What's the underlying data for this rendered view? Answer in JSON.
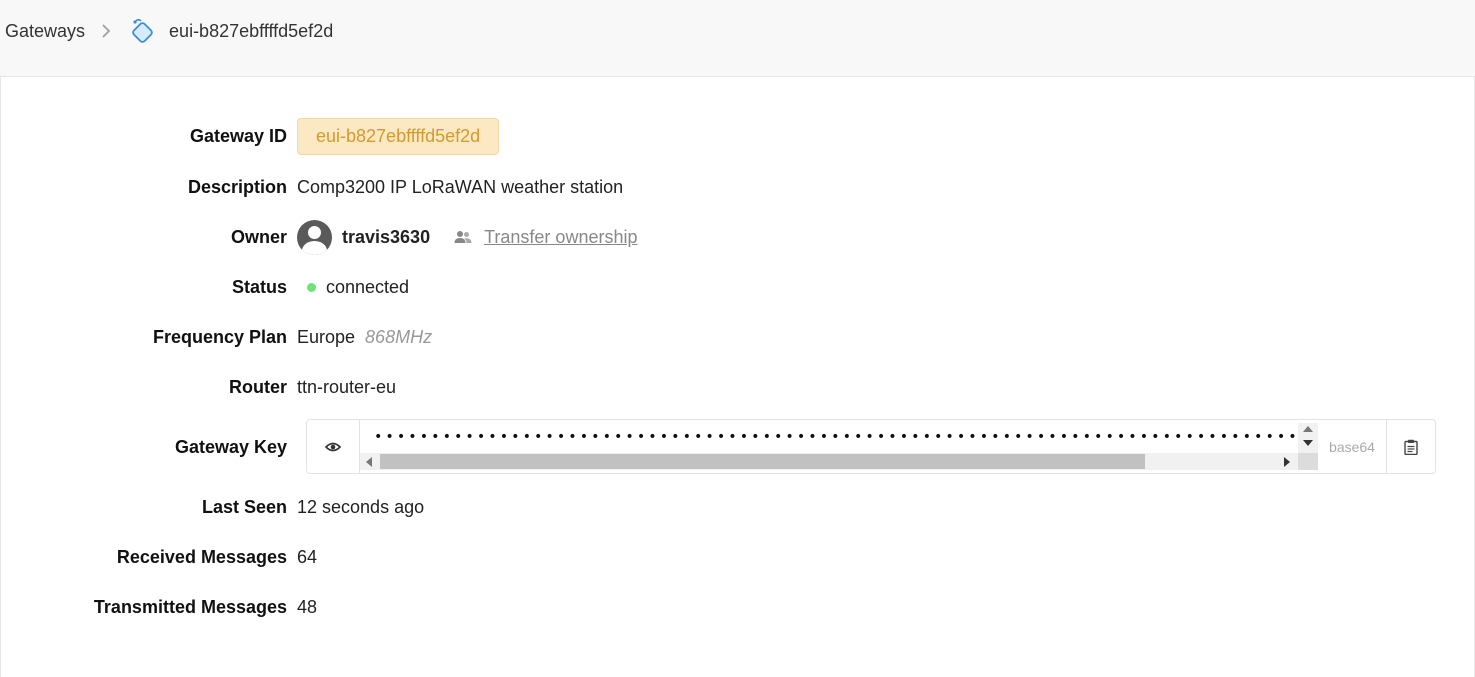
{
  "breadcrumb": {
    "root": "Gateways",
    "current": "eui-b827ebffffd5ef2d"
  },
  "fields": {
    "gateway_id": {
      "label": "Gateway ID",
      "value": "eui-b827ebffffd5ef2d"
    },
    "description": {
      "label": "Description",
      "value": "Comp3200 IP LoRaWAN weather station"
    },
    "owner": {
      "label": "Owner",
      "username": "travis3630",
      "transfer_label": "Transfer ownership"
    },
    "status": {
      "label": "Status",
      "value": "connected",
      "color": "#6ee27a"
    },
    "frequency_plan": {
      "label": "Frequency Plan",
      "region": "Europe",
      "band": "868MHz"
    },
    "router": {
      "label": "Router",
      "value": "ttn-router-eu"
    },
    "gateway_key": {
      "label": "Gateway Key",
      "masked": "••••••••••••••••••••••••••••••••••••••••••••••••••••••••••••••••••••••••••••••••••••••••••••••••••••",
      "encoding": "base64"
    },
    "last_seen": {
      "label": "Last Seen",
      "value": "12 seconds ago"
    },
    "received": {
      "label": "Received Messages",
      "value": "64"
    },
    "transmitted": {
      "label": "Transmitted Messages",
      "value": "48"
    }
  },
  "icons": {
    "breadcrumb_sep": "chevron-right-icon",
    "gateway": "gateway-icon",
    "avatar": "user-avatar-icon",
    "transfer": "users-icon",
    "reveal": "eye-icon",
    "copy": "clipboard-icon"
  },
  "colors": {
    "id_badge_bg": "#fde8c4",
    "id_badge_text": "#d39a2c"
  }
}
